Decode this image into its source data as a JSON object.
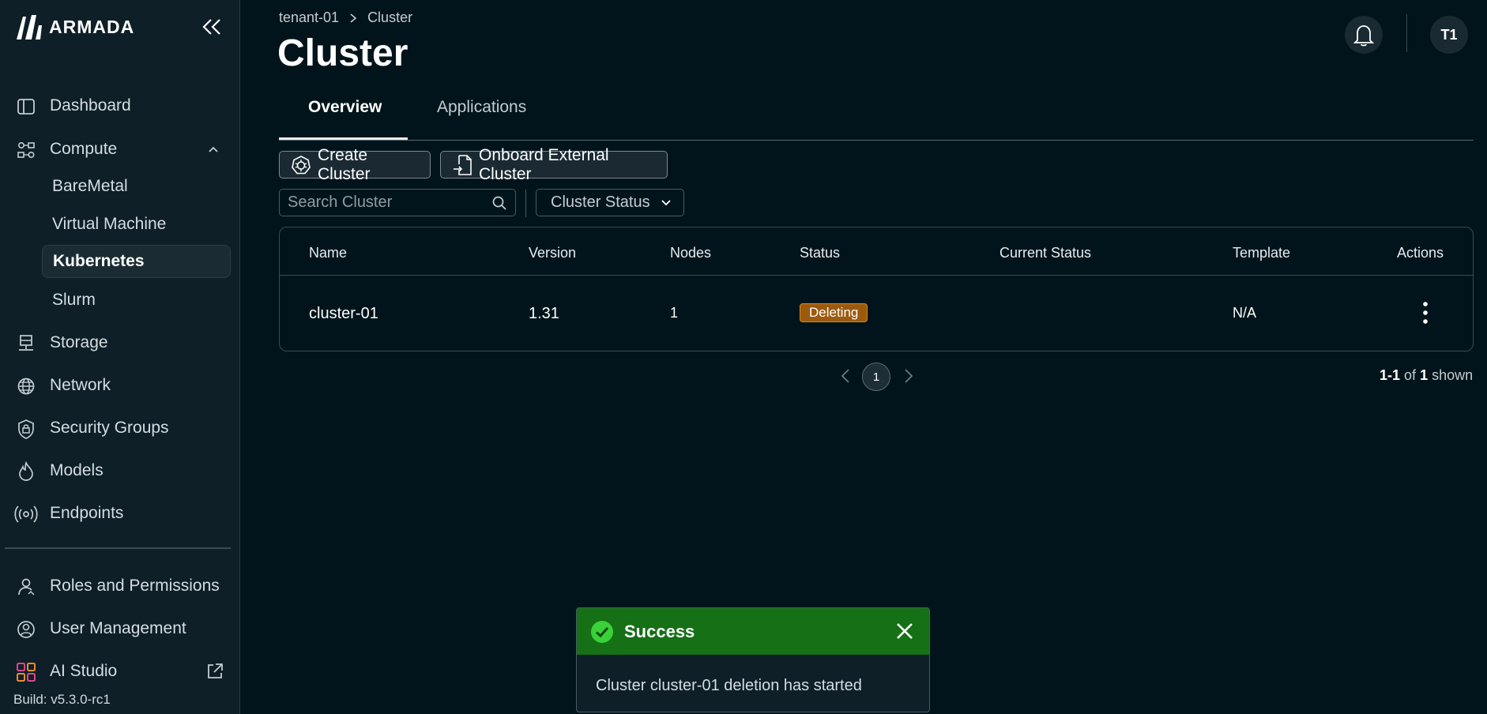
{
  "brand": {
    "name": "ARMADA"
  },
  "sidebar": {
    "items": [
      {
        "label": "Dashboard"
      },
      {
        "label": "Compute"
      },
      {
        "label": "Storage"
      },
      {
        "label": "Network"
      },
      {
        "label": "Security Groups"
      },
      {
        "label": "Models"
      },
      {
        "label": "Endpoints"
      },
      {
        "label": "Roles and Permissions"
      },
      {
        "label": "User Management"
      },
      {
        "label": "AI Studio"
      }
    ],
    "compute_children": [
      {
        "label": "BareMetal"
      },
      {
        "label": "Virtual Machine"
      },
      {
        "label": "Kubernetes",
        "active": true
      },
      {
        "label": "Slurm"
      }
    ],
    "build": "Build: v5.3.0-rc1"
  },
  "breadcrumb": {
    "parent": "tenant-01",
    "current": "Cluster"
  },
  "header": {
    "title": "Cluster",
    "avatar_initials": "T1"
  },
  "tabs": [
    {
      "label": "Overview",
      "active": true
    },
    {
      "label": "Applications",
      "active": false
    }
  ],
  "toolbar": {
    "create_label": "Create Cluster",
    "onboard_label": "Onboard External Cluster",
    "search_placeholder": "Search Cluster",
    "status_filter_label": "Cluster Status"
  },
  "table": {
    "columns": [
      "Name",
      "Version",
      "Nodes",
      "Status",
      "Current Status",
      "Template",
      "Actions"
    ],
    "rows": [
      {
        "name": "cluster-01",
        "version": "1.31",
        "nodes": "1",
        "status": "Deleting",
        "current_status": "",
        "template": "N/A"
      }
    ]
  },
  "pagination": {
    "page": "1",
    "range": "1-1",
    "of_word": "of",
    "total": "1",
    "shown_word": "shown"
  },
  "toast": {
    "title": "Success",
    "message": "Cluster cluster-01 deletion has started",
    "color": "#157016"
  },
  "colors": {
    "background": "#02141b",
    "sidebar": "#0e1f28",
    "deleting_badge": "#9b5a0e",
    "success": "#157016"
  }
}
